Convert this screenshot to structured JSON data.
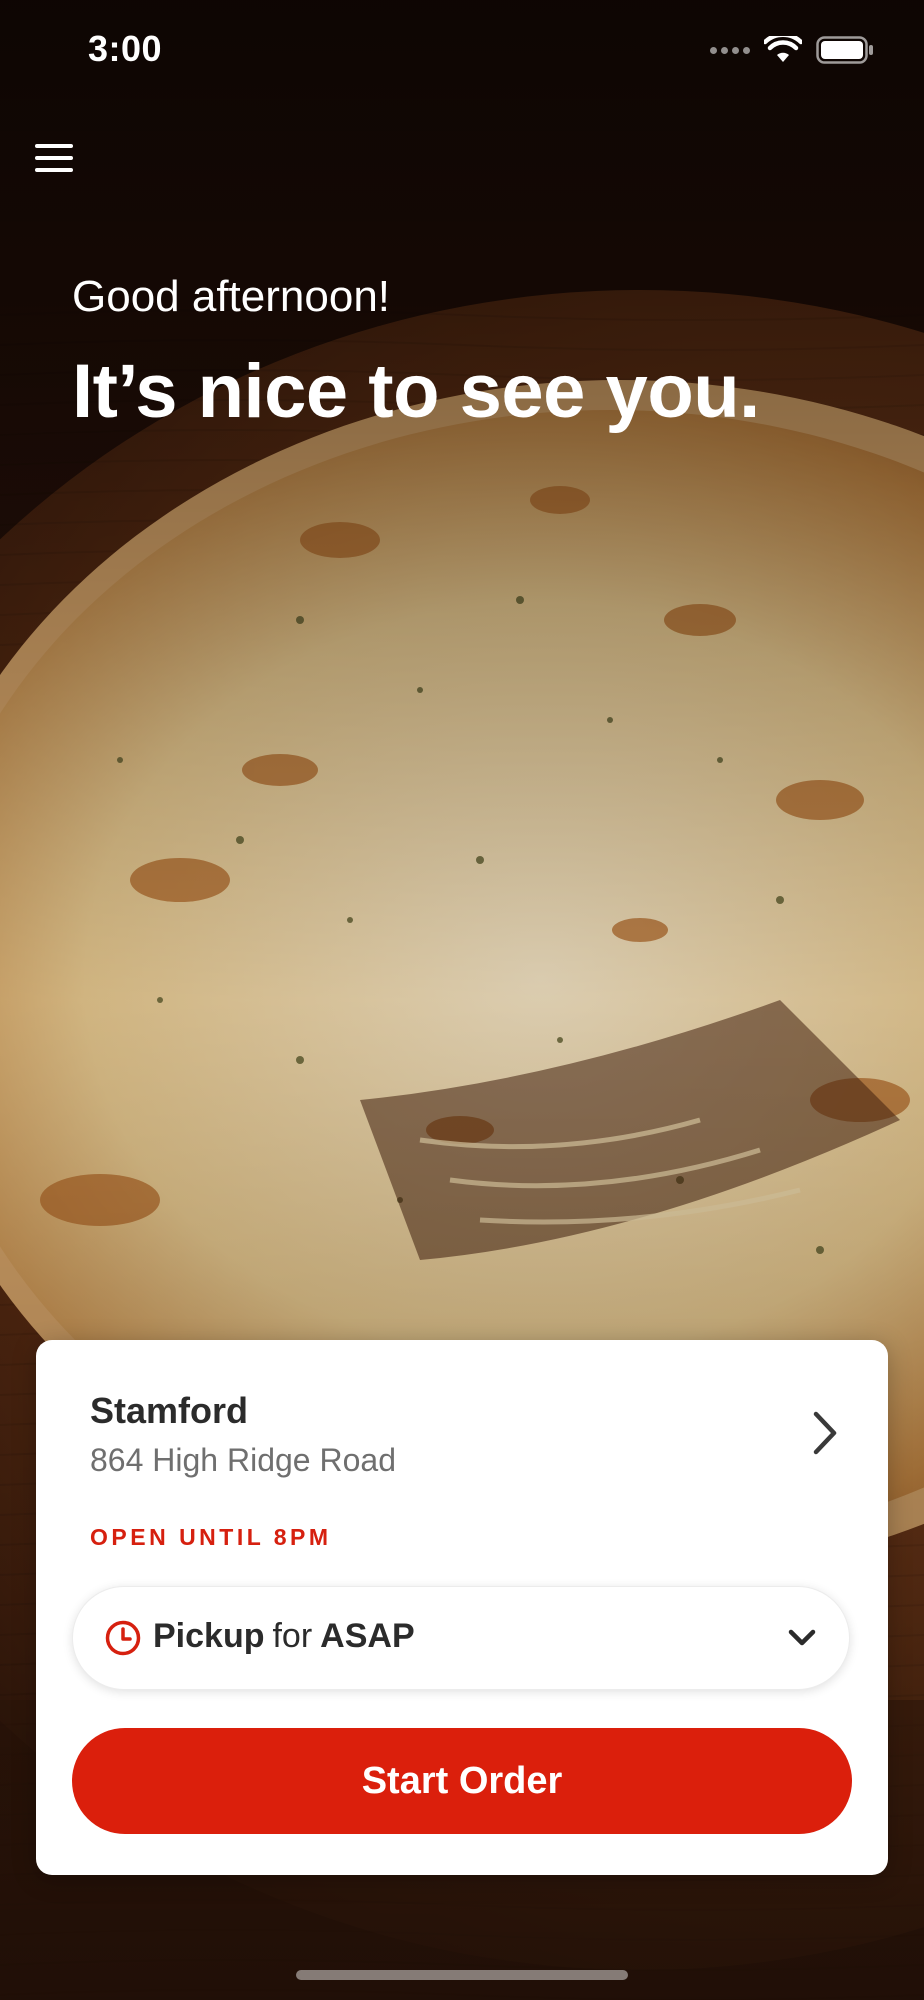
{
  "status_bar": {
    "time": "3:00",
    "icons": [
      "cellular-signal-icon",
      "wifi-icon",
      "battery-icon"
    ]
  },
  "menu": {
    "icon": "hamburger-menu-icon"
  },
  "hero": {
    "greeting": "Good afternoon!",
    "headline": "It’s nice to see you."
  },
  "store": {
    "name": "Stamford",
    "address": "864 High Ridge Road",
    "open_status": "OPEN UNTIL 8PM",
    "chevron_icon": "chevron-right-icon"
  },
  "order_type": {
    "icon": "clock-icon",
    "method": "Pickup",
    "connector": "for",
    "time": "ASAP",
    "dropdown_icon": "chevron-down-icon"
  },
  "actions": {
    "start_order_label": "Start Order"
  },
  "colors": {
    "brand_red": "#db1f0c",
    "status_red": "#d6200f",
    "card_background": "#ffffff",
    "primary_text": "#2b2b2b",
    "secondary_text": "#6f6f6f"
  }
}
